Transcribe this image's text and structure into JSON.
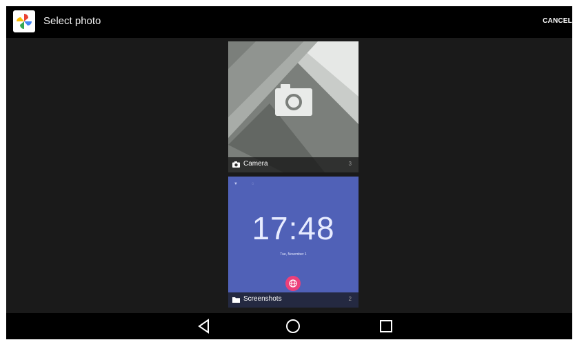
{
  "header": {
    "title": "Select photo",
    "cancel_label": "CANCEL",
    "app_icon": "pinwheel-photos-icon"
  },
  "albums": [
    {
      "name": "Camera",
      "count": "3",
      "icon": "camera-icon"
    },
    {
      "name": "Screenshots",
      "count": "2",
      "icon": "folder-icon"
    }
  ],
  "screenshot_preview": {
    "time": "17:48",
    "date": "Tue, November 1"
  },
  "navbar": {
    "back": "back-triangle-icon",
    "home": "home-circle-icon",
    "recents": "recents-square-icon"
  },
  "colors": {
    "background": "#1a1a1a",
    "actionbar": "#000000",
    "lockscreen_blue": "#5061b7",
    "fab_pink": "#ec407a"
  }
}
